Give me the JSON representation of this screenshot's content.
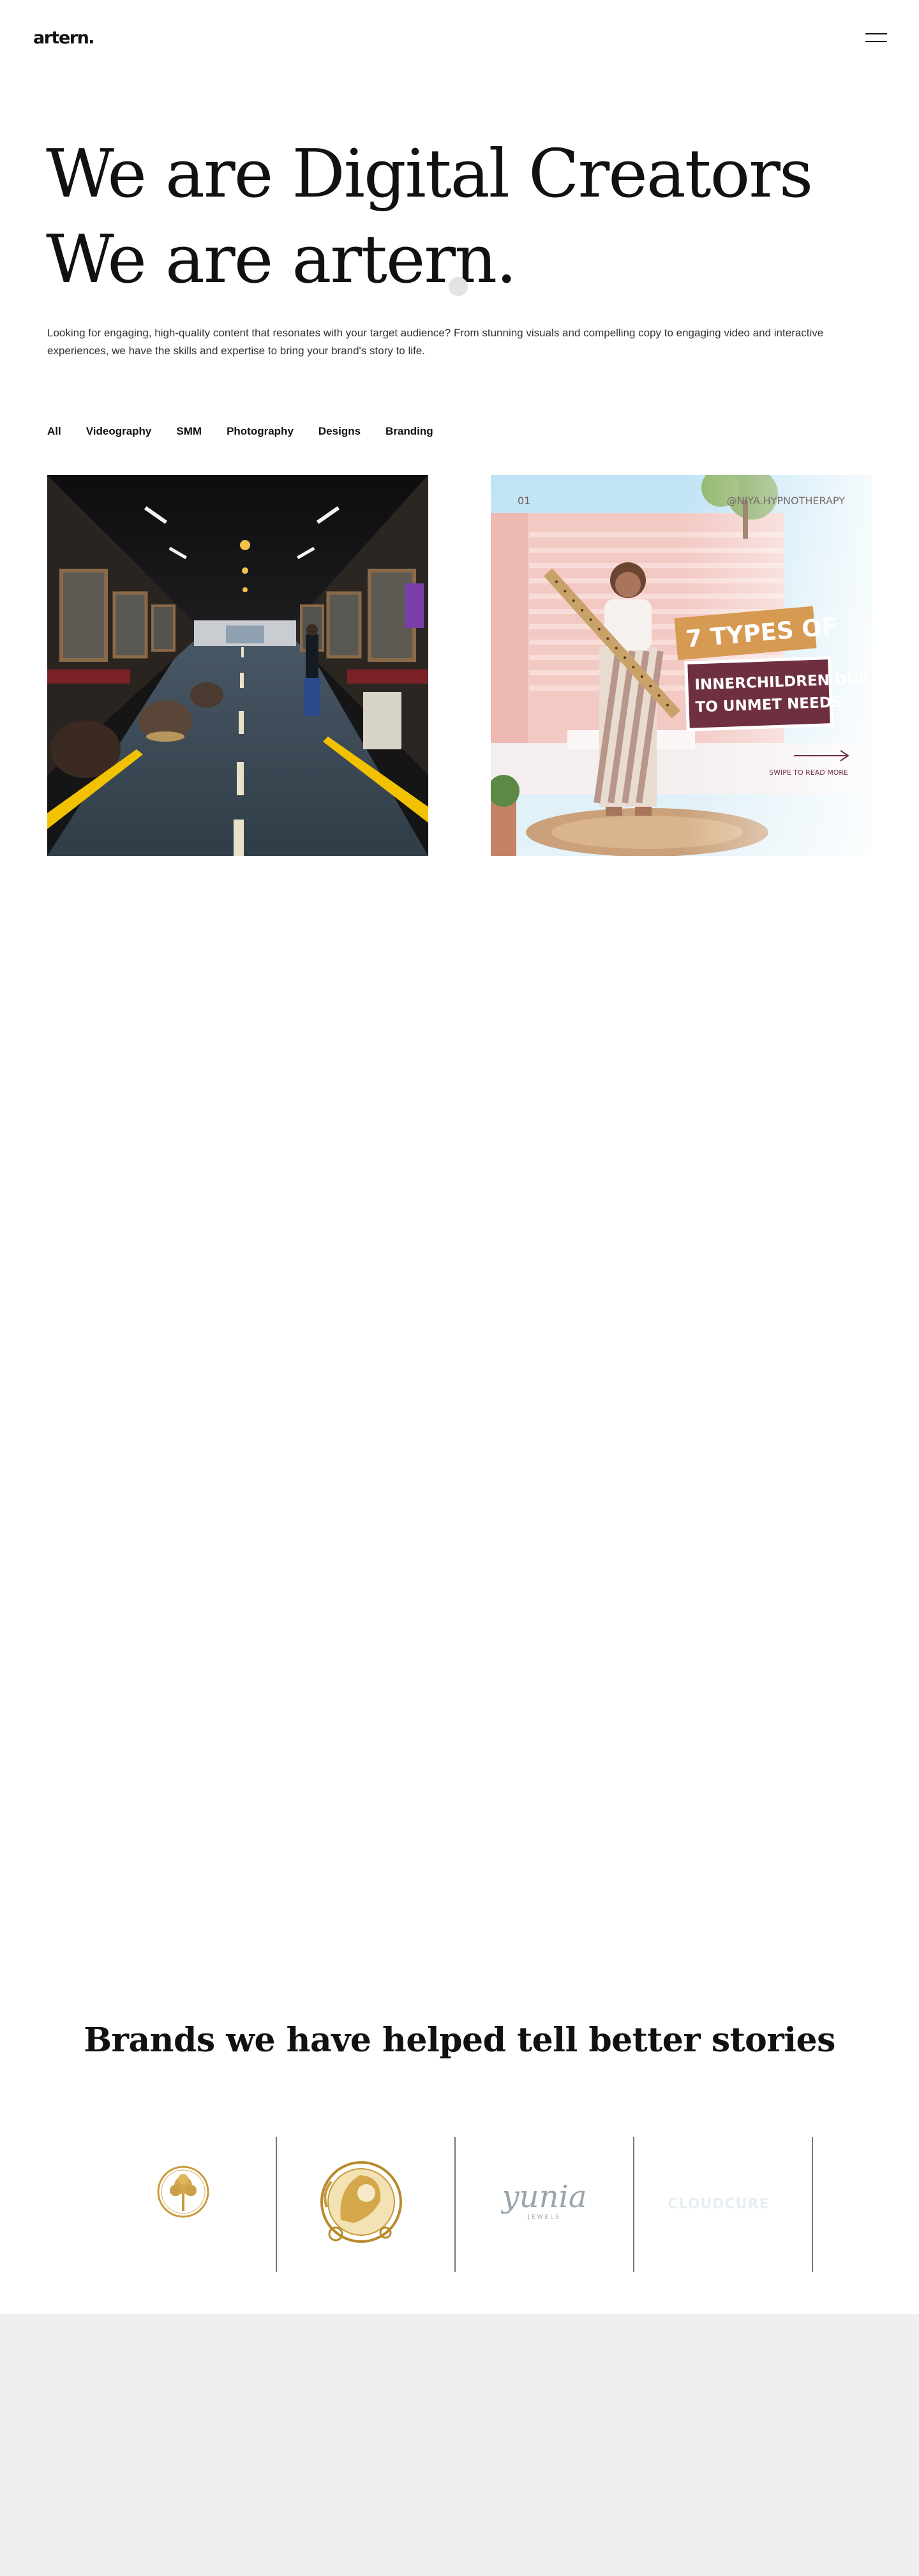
{
  "header": {
    "logo_text": "artern.",
    "menu_icon": "hamburger-menu-icon"
  },
  "hero": {
    "title_line1": "We are Digital Creators",
    "title_line2": "We are artern.",
    "description": "Looking for engaging, high-quality content that resonates with your target audience? From stunning visuals and compelling copy to engaging video and interactive experiences, we have the skills and expertise to bring your brand's story to life."
  },
  "filters": [
    "All",
    "Videography",
    "SMM",
    "Photography",
    "Designs",
    "Branding"
  ],
  "portfolio": {
    "left_image": "barbershop-interior-photo",
    "right_image": {
      "kind": "social-post-graphic",
      "post_number": "01",
      "handle": "@NIYA.HYPNOTHERAPY",
      "headline": "7 TYPES OF",
      "subline1": "INNERCHILDREN DUE",
      "subline2": "TO UNMET NEEDS",
      "swipe_text": "SWIPE TO READ MORE"
    }
  },
  "brands": {
    "title": "Brands we have helped tell better stories",
    "logos": [
      {
        "name": "gold-tree-emblem-logo"
      },
      {
        "name": "gold-ornate-portrait-logo"
      },
      {
        "name": "script-wordmark-logo",
        "text": "yunia",
        "subtext": "JEWELS"
      },
      {
        "name": "faint-wordmark-logo",
        "text": "CLOUDCURE"
      }
    ]
  },
  "colors": {
    "text": "#111111",
    "accent_gold": "#c9993a",
    "post_pink": "#f3c9c4",
    "post_badge_orange": "#d69a52",
    "post_badge_maroon": "#6e3040",
    "footer_band": "#efefef"
  }
}
